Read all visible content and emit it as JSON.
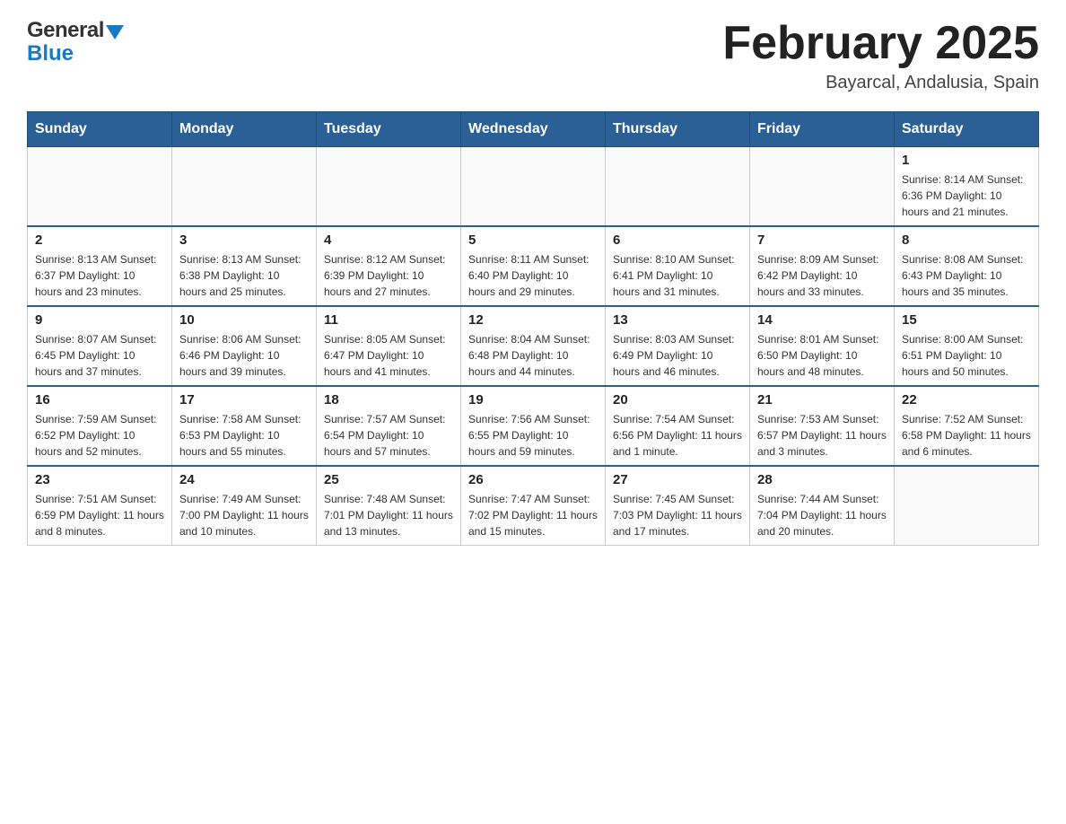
{
  "header": {
    "logo_general": "General",
    "logo_blue": "Blue",
    "month_title": "February 2025",
    "location": "Bayarcal, Andalusia, Spain"
  },
  "days_of_week": [
    "Sunday",
    "Monday",
    "Tuesday",
    "Wednesday",
    "Thursday",
    "Friday",
    "Saturday"
  ],
  "weeks": [
    {
      "days": [
        {
          "num": "",
          "info": ""
        },
        {
          "num": "",
          "info": ""
        },
        {
          "num": "",
          "info": ""
        },
        {
          "num": "",
          "info": ""
        },
        {
          "num": "",
          "info": ""
        },
        {
          "num": "",
          "info": ""
        },
        {
          "num": "1",
          "info": "Sunrise: 8:14 AM\nSunset: 6:36 PM\nDaylight: 10 hours and 21 minutes."
        }
      ]
    },
    {
      "days": [
        {
          "num": "2",
          "info": "Sunrise: 8:13 AM\nSunset: 6:37 PM\nDaylight: 10 hours and 23 minutes."
        },
        {
          "num": "3",
          "info": "Sunrise: 8:13 AM\nSunset: 6:38 PM\nDaylight: 10 hours and 25 minutes."
        },
        {
          "num": "4",
          "info": "Sunrise: 8:12 AM\nSunset: 6:39 PM\nDaylight: 10 hours and 27 minutes."
        },
        {
          "num": "5",
          "info": "Sunrise: 8:11 AM\nSunset: 6:40 PM\nDaylight: 10 hours and 29 minutes."
        },
        {
          "num": "6",
          "info": "Sunrise: 8:10 AM\nSunset: 6:41 PM\nDaylight: 10 hours and 31 minutes."
        },
        {
          "num": "7",
          "info": "Sunrise: 8:09 AM\nSunset: 6:42 PM\nDaylight: 10 hours and 33 minutes."
        },
        {
          "num": "8",
          "info": "Sunrise: 8:08 AM\nSunset: 6:43 PM\nDaylight: 10 hours and 35 minutes."
        }
      ]
    },
    {
      "days": [
        {
          "num": "9",
          "info": "Sunrise: 8:07 AM\nSunset: 6:45 PM\nDaylight: 10 hours and 37 minutes."
        },
        {
          "num": "10",
          "info": "Sunrise: 8:06 AM\nSunset: 6:46 PM\nDaylight: 10 hours and 39 minutes."
        },
        {
          "num": "11",
          "info": "Sunrise: 8:05 AM\nSunset: 6:47 PM\nDaylight: 10 hours and 41 minutes."
        },
        {
          "num": "12",
          "info": "Sunrise: 8:04 AM\nSunset: 6:48 PM\nDaylight: 10 hours and 44 minutes."
        },
        {
          "num": "13",
          "info": "Sunrise: 8:03 AM\nSunset: 6:49 PM\nDaylight: 10 hours and 46 minutes."
        },
        {
          "num": "14",
          "info": "Sunrise: 8:01 AM\nSunset: 6:50 PM\nDaylight: 10 hours and 48 minutes."
        },
        {
          "num": "15",
          "info": "Sunrise: 8:00 AM\nSunset: 6:51 PM\nDaylight: 10 hours and 50 minutes."
        }
      ]
    },
    {
      "days": [
        {
          "num": "16",
          "info": "Sunrise: 7:59 AM\nSunset: 6:52 PM\nDaylight: 10 hours and 52 minutes."
        },
        {
          "num": "17",
          "info": "Sunrise: 7:58 AM\nSunset: 6:53 PM\nDaylight: 10 hours and 55 minutes."
        },
        {
          "num": "18",
          "info": "Sunrise: 7:57 AM\nSunset: 6:54 PM\nDaylight: 10 hours and 57 minutes."
        },
        {
          "num": "19",
          "info": "Sunrise: 7:56 AM\nSunset: 6:55 PM\nDaylight: 10 hours and 59 minutes."
        },
        {
          "num": "20",
          "info": "Sunrise: 7:54 AM\nSunset: 6:56 PM\nDaylight: 11 hours and 1 minute."
        },
        {
          "num": "21",
          "info": "Sunrise: 7:53 AM\nSunset: 6:57 PM\nDaylight: 11 hours and 3 minutes."
        },
        {
          "num": "22",
          "info": "Sunrise: 7:52 AM\nSunset: 6:58 PM\nDaylight: 11 hours and 6 minutes."
        }
      ]
    },
    {
      "days": [
        {
          "num": "23",
          "info": "Sunrise: 7:51 AM\nSunset: 6:59 PM\nDaylight: 11 hours and 8 minutes."
        },
        {
          "num": "24",
          "info": "Sunrise: 7:49 AM\nSunset: 7:00 PM\nDaylight: 11 hours and 10 minutes."
        },
        {
          "num": "25",
          "info": "Sunrise: 7:48 AM\nSunset: 7:01 PM\nDaylight: 11 hours and 13 minutes."
        },
        {
          "num": "26",
          "info": "Sunrise: 7:47 AM\nSunset: 7:02 PM\nDaylight: 11 hours and 15 minutes."
        },
        {
          "num": "27",
          "info": "Sunrise: 7:45 AM\nSunset: 7:03 PM\nDaylight: 11 hours and 17 minutes."
        },
        {
          "num": "28",
          "info": "Sunrise: 7:44 AM\nSunset: 7:04 PM\nDaylight: 11 hours and 20 minutes."
        },
        {
          "num": "",
          "info": ""
        }
      ]
    }
  ]
}
